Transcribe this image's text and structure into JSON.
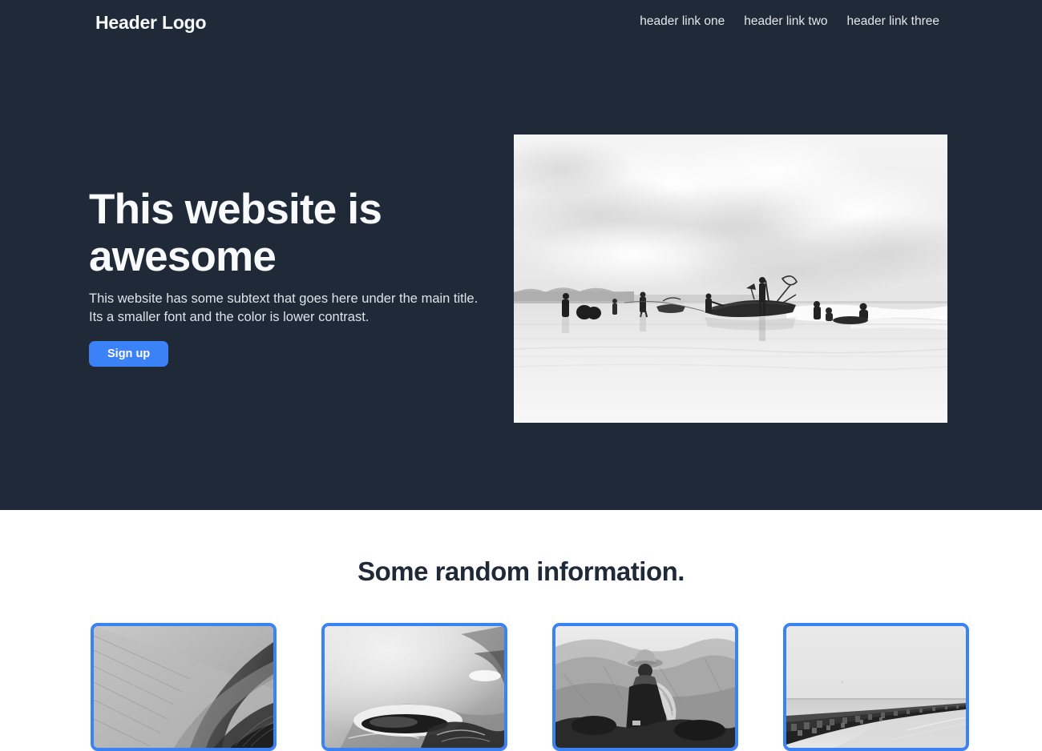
{
  "header": {
    "logo": "Header Logo",
    "nav": [
      {
        "label": "header link one"
      },
      {
        "label": "header link two"
      },
      {
        "label": "header link three"
      }
    ]
  },
  "hero": {
    "title": "This website is awesome",
    "subtext": "This website has some subtext that goes here under the main title. Its a smaller font and the color is lower contrast.",
    "cta_label": "Sign up",
    "image_alt": "grayscale beach scene with fishermen pulling a boat"
  },
  "info": {
    "heading": "Some random information.",
    "cards": [
      {
        "image_alt": "grayscale sand dunes"
      },
      {
        "image_alt": "grayscale abstract water ripple"
      },
      {
        "image_alt": "grayscale portrait of person in hat near mountains"
      },
      {
        "image_alt": "grayscale breakwater jetty at sea"
      }
    ]
  },
  "colors": {
    "dark_background": "#1f2937",
    "accent_blue": "#3b82f6",
    "light_text": "#f9fafb",
    "subtext": "#dfe3e9",
    "page_background": "#ffffff"
  }
}
